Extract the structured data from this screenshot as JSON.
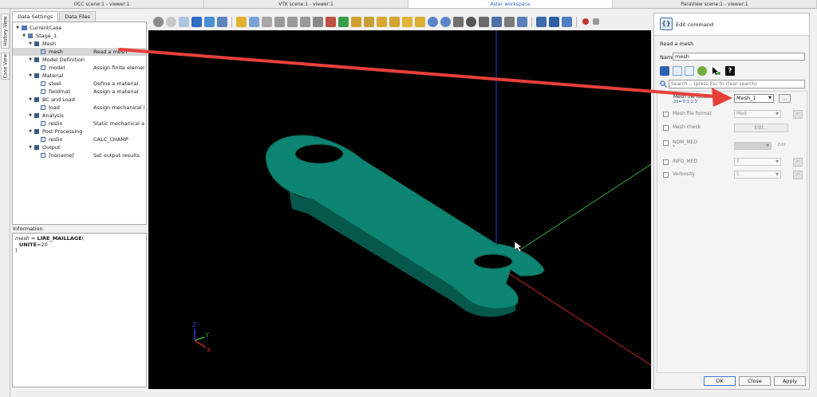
{
  "scene_tabs": [
    {
      "label": "OCC scene:1 - viewer:1",
      "active": false
    },
    {
      "label": "VTK scene:1 - viewer:1",
      "active": false
    },
    {
      "label": "Aster workspace",
      "active": true
    },
    {
      "label": "ParaView scene:1 - viewer:1",
      "active": false
    }
  ],
  "side_tabs": {
    "history": "History View",
    "case": "Case View"
  },
  "data_tabs": [
    "Data Settings",
    "Data Files"
  ],
  "tree": {
    "case": "CurrentCase",
    "stage": "Stage_1",
    "mesh_cat": "Mesh",
    "mesh_cmd": "mesh",
    "mesh_desc": "Read a mesh",
    "model_cat": "Model Definition",
    "model_cmd": "model",
    "model_desc": "Assign finite element",
    "material_cat": "Material",
    "steel_cmd": "steel",
    "steel_desc": "Define a material",
    "fieldmat_cmd": "fieldmat",
    "fieldmat_desc": "Assign a material",
    "bc_cat": "BC and Load",
    "load_cmd": "load",
    "load_desc": "Assign mechanical l...",
    "analysis_cat": "Analysis",
    "reslin_cmd": "reslin",
    "reslin_desc": "Static mechanical a...",
    "post_cat": "Post Processing",
    "reslin2_cmd": "reslin",
    "reslin2_desc": "CALC_CHAMP",
    "output_cat": "Output",
    "noname_cmd": "[noname]",
    "noname_desc": "Set output results"
  },
  "information": {
    "title": "Information",
    "line1_var": "mesh",
    "line1_eq": " = ",
    "line1_cmd": "LIRE_MAILLAGE",
    "line1_paren": "(",
    "line2_kw": "UNITE",
    "line2_val": "=20",
    "line3": ")"
  },
  "command_panel": {
    "header_title": "Edit command",
    "header_icon_glyph": "{}",
    "description": "Read a mesh",
    "name_label": "Name",
    "name_value": "mesh",
    "search_placeholder": "Search... (press Esc to clear search)",
    "mesh_location_label": "Mesh file locati...",
    "mesh_location_sub": "20='0:1:1:3'",
    "mesh_location_value": "Mesh_1",
    "browse_label": "...",
    "params": [
      {
        "label": "Mesh file format",
        "value": "Med",
        "kind": "combo"
      },
      {
        "label": "Mesh check",
        "value": "Edit...",
        "kind": "button"
      },
      {
        "label": "NOM_MED",
        "value": "",
        "kind": "combo_edit",
        "extra": "Edit"
      },
      {
        "label": "INFO_MED",
        "value": "1",
        "kind": "combo"
      },
      {
        "label": "Verbosity",
        "value": "1",
        "kind": "combo"
      }
    ],
    "nom_med_sub": "*",
    "ok": "OK",
    "close": "Close",
    "apply": "Apply"
  },
  "axes_triad": {
    "z": "Z",
    "y": "Y",
    "x": "X"
  },
  "colors": {
    "tab_active_text": "#2a66c8",
    "mesh_green": "#0a7a6a",
    "arrow_red": "#e8403a",
    "axis_blue": "#2f3fd8",
    "axis_green": "#2fa83c",
    "axis_red": "#c02020"
  }
}
